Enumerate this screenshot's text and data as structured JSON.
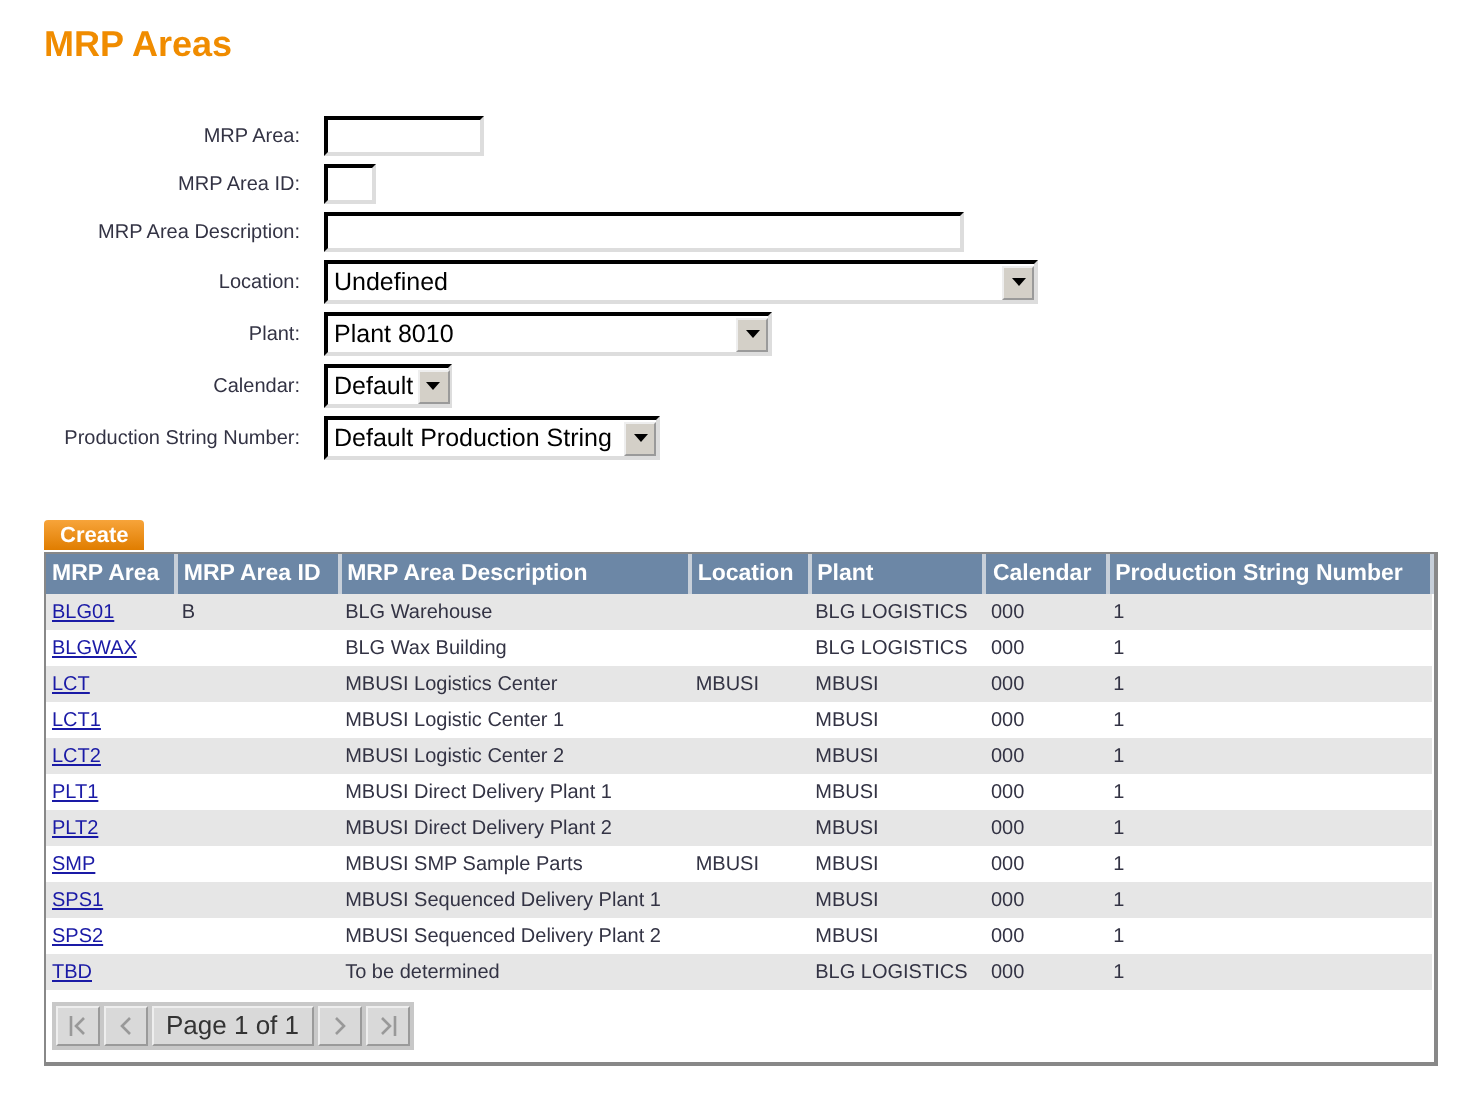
{
  "title": "MRP Areas",
  "form": [
    {
      "label": "MRP Area:",
      "kind": "text"
    },
    {
      "label": "MRP Area ID:",
      "kind": "text"
    },
    {
      "label": "MRP Area Description:",
      "kind": "text"
    },
    {
      "label": "Location:",
      "kind": "select",
      "value": "Undefined"
    },
    {
      "label": "Plant:",
      "kind": "select",
      "value": "Plant 8010"
    },
    {
      "label": "Calendar:",
      "kind": "select",
      "value": "Default"
    },
    {
      "label": "Production String Number:",
      "kind": "select",
      "value": "Default Production String"
    }
  ],
  "create_button": "Create",
  "table": {
    "columns": [
      "MRP Area",
      "MRP Area ID",
      "MRP Area Description",
      "Location",
      "Plant",
      "Calendar",
      "Production String Number"
    ],
    "rows": [
      [
        "BLG01",
        "B",
        "BLG Warehouse",
        "",
        "BLG LOGISTICS",
        "000",
        "1"
      ],
      [
        "BLGWAX",
        "",
        "BLG Wax Building",
        "",
        "BLG LOGISTICS",
        "000",
        "1"
      ],
      [
        "LCT",
        "",
        "MBUSI Logistics Center",
        "MBUSI",
        "MBUSI",
        "000",
        "1"
      ],
      [
        "LCT1",
        "",
        "MBUSI Logistic Center 1",
        "",
        "MBUSI",
        "000",
        "1"
      ],
      [
        "LCT2",
        "",
        "MBUSI Logistic Center 2",
        "",
        "MBUSI",
        "000",
        "1"
      ],
      [
        "PLT1",
        "",
        "MBUSI Direct Delivery Plant 1",
        "",
        "MBUSI",
        "000",
        "1"
      ],
      [
        "PLT2",
        "",
        "MBUSI Direct Delivery Plant 2",
        "",
        "MBUSI",
        "000",
        "1"
      ],
      [
        "SMP",
        "",
        "MBUSI SMP Sample Parts",
        "MBUSI",
        "MBUSI",
        "000",
        "1"
      ],
      [
        "SPS1",
        "",
        "MBUSI Sequenced Delivery Plant 1",
        "",
        "MBUSI",
        "000",
        "1"
      ],
      [
        "SPS2",
        "",
        "MBUSI Sequenced Delivery Plant 2",
        "",
        "MBUSI",
        "000",
        "1"
      ],
      [
        "TBD",
        "",
        "To be determined",
        "",
        "BLG LOGISTICS",
        "000",
        "1"
      ]
    ]
  },
  "pager": {
    "text": "Page 1 of 1",
    "disabled": true
  }
}
